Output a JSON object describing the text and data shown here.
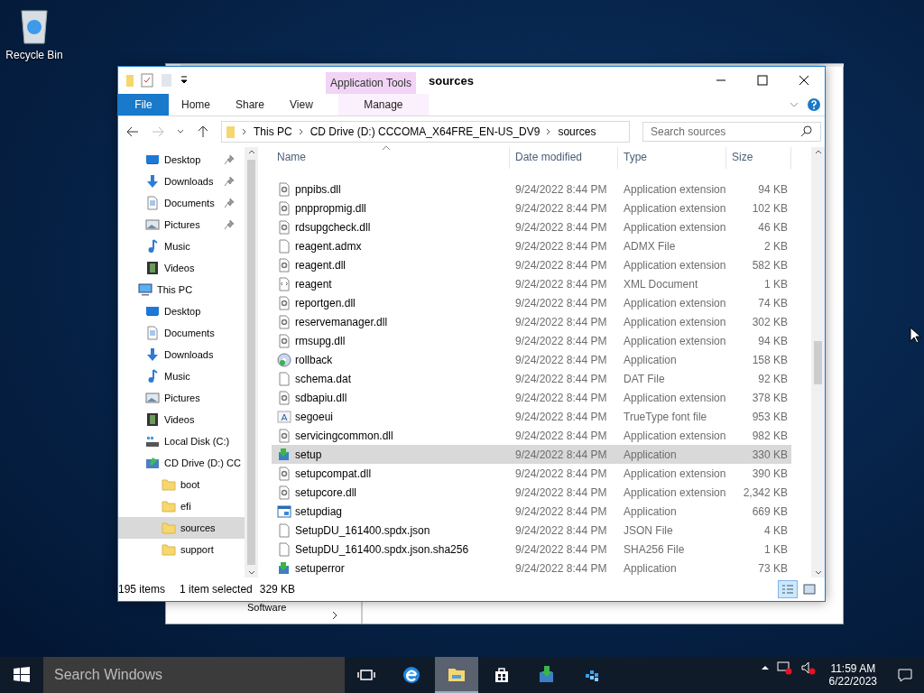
{
  "desktop_icons": [
    {
      "label": "Recycle Bin",
      "kind": "recycle"
    }
  ],
  "background_window": {
    "nav_item": "Software"
  },
  "window": {
    "title": "sources",
    "context_tab_group": "Application Tools",
    "ribbon_tabs": [
      {
        "label": "File",
        "kind": "file",
        "selected": false
      },
      {
        "label": "Home",
        "kind": "tab",
        "selected": false
      },
      {
        "label": "Share",
        "kind": "tab",
        "selected": false
      },
      {
        "label": "View",
        "kind": "tab",
        "selected": false
      },
      {
        "label": "Manage",
        "kind": "context",
        "selected": false
      }
    ],
    "address": {
      "breadcrumbs": [
        "This PC",
        "CD Drive (D:) CCCOMA_X64FRE_EN-US_DV9",
        "sources"
      ]
    },
    "search": {
      "placeholder": "Search sources"
    },
    "nav": [
      {
        "label": "Desktop",
        "kind": "desktop",
        "pinned": true,
        "selected": false
      },
      {
        "label": "Downloads",
        "kind": "downloads",
        "pinned": true,
        "selected": false
      },
      {
        "label": "Documents",
        "kind": "documents",
        "pinned": true,
        "selected": false
      },
      {
        "label": "Pictures",
        "kind": "pictures",
        "pinned": true,
        "selected": false
      },
      {
        "label": "Music",
        "kind": "music",
        "pinned": false,
        "selected": false
      },
      {
        "label": "Videos",
        "kind": "videos",
        "pinned": false,
        "selected": false
      },
      {
        "label": "This PC",
        "kind": "pc",
        "pinned": false,
        "selected": false,
        "children": [
          {
            "label": "Desktop",
            "kind": "desktop",
            "pinned": false,
            "selected": false
          },
          {
            "label": "Documents",
            "kind": "documents",
            "pinned": false,
            "selected": false
          },
          {
            "label": "Downloads",
            "kind": "downloads",
            "pinned": false,
            "selected": false
          },
          {
            "label": "Music",
            "kind": "music",
            "pinned": false,
            "selected": false
          },
          {
            "label": "Pictures",
            "kind": "pictures",
            "pinned": false,
            "selected": false
          },
          {
            "label": "Videos",
            "kind": "videos",
            "pinned": false,
            "selected": false
          },
          {
            "label": "Local Disk (C:)",
            "kind": "disk",
            "pinned": false,
            "selected": false
          },
          {
            "label": "CD Drive (D:) CC",
            "kind": "cd",
            "pinned": false,
            "selected": false,
            "children": [
              {
                "label": "boot",
                "kind": "folder",
                "pinned": false,
                "selected": false
              },
              {
                "label": "efi",
                "kind": "folder",
                "pinned": false,
                "selected": false
              },
              {
                "label": "sources",
                "kind": "folder",
                "pinned": false,
                "selected": true
              },
              {
                "label": "support",
                "kind": "folder",
                "pinned": false,
                "selected": false
              }
            ]
          }
        ]
      }
    ],
    "table": {
      "columns": [
        "Name",
        "Date modified",
        "Type",
        "Size"
      ],
      "rows": [
        {
          "name": "pnpibs.dll",
          "kind": "dll",
          "date": "9/24/2022 8:44 PM",
          "type": "Application extension",
          "size": "94 KB",
          "selected": false
        },
        {
          "name": "pnppropmig.dll",
          "kind": "dll",
          "date": "9/24/2022 8:44 PM",
          "type": "Application extension",
          "size": "102 KB",
          "selected": false
        },
        {
          "name": "rdsupgcheck.dll",
          "kind": "dll",
          "date": "9/24/2022 8:44 PM",
          "type": "Application extension",
          "size": "46 KB",
          "selected": false
        },
        {
          "name": "reagent.admx",
          "kind": "file",
          "date": "9/24/2022 8:44 PM",
          "type": "ADMX File",
          "size": "2 KB",
          "selected": false
        },
        {
          "name": "reagent.dll",
          "kind": "dll",
          "date": "9/24/2022 8:44 PM",
          "type": "Application extension",
          "size": "582 KB",
          "selected": false
        },
        {
          "name": "reagent",
          "kind": "xml",
          "date": "9/24/2022 8:44 PM",
          "type": "XML Document",
          "size": "1 KB",
          "selected": false
        },
        {
          "name": "reportgen.dll",
          "kind": "dll",
          "date": "9/24/2022 8:44 PM",
          "type": "Application extension",
          "size": "74 KB",
          "selected": false
        },
        {
          "name": "reservemanager.dll",
          "kind": "dll",
          "date": "9/24/2022 8:44 PM",
          "type": "Application extension",
          "size": "302 KB",
          "selected": false
        },
        {
          "name": "rmsupg.dll",
          "kind": "dll",
          "date": "9/24/2022 8:44 PM",
          "type": "Application extension",
          "size": "94 KB",
          "selected": false
        },
        {
          "name": "rollback",
          "kind": "disc",
          "date": "9/24/2022 8:44 PM",
          "type": "Application",
          "size": "158 KB",
          "selected": false
        },
        {
          "name": "schema.dat",
          "kind": "file",
          "date": "9/24/2022 8:44 PM",
          "type": "DAT File",
          "size": "92 KB",
          "selected": false
        },
        {
          "name": "sdbapiu.dll",
          "kind": "dll",
          "date": "9/24/2022 8:44 PM",
          "type": "Application extension",
          "size": "378 KB",
          "selected": false
        },
        {
          "name": "segoeui",
          "kind": "font",
          "date": "9/24/2022 8:44 PM",
          "type": "TrueType font file",
          "size": "953 KB",
          "selected": false
        },
        {
          "name": "servicingcommon.dll",
          "kind": "dll",
          "date": "9/24/2022 8:44 PM",
          "type": "Application extension",
          "size": "982 KB",
          "selected": false
        },
        {
          "name": "setup",
          "kind": "setup",
          "date": "9/24/2022 8:44 PM",
          "type": "Application",
          "size": "330 KB",
          "selected": true
        },
        {
          "name": "setupcompat.dll",
          "kind": "dll",
          "date": "9/24/2022 8:44 PM",
          "type": "Application extension",
          "size": "390 KB",
          "selected": false
        },
        {
          "name": "setupcore.dll",
          "kind": "dll",
          "date": "9/24/2022 8:44 PM",
          "type": "Application extension",
          "size": "2,342 KB",
          "selected": false
        },
        {
          "name": "setupdiag",
          "kind": "app",
          "date": "9/24/2022 8:44 PM",
          "type": "Application",
          "size": "669 KB",
          "selected": false
        },
        {
          "name": "SetupDU_161400.spdx.json",
          "kind": "file",
          "date": "9/24/2022 8:44 PM",
          "type": "JSON File",
          "size": "4 KB",
          "selected": false
        },
        {
          "name": "SetupDU_161400.spdx.json.sha256",
          "kind": "file",
          "date": "9/24/2022 8:44 PM",
          "type": "SHA256 File",
          "size": "1 KB",
          "selected": false
        },
        {
          "name": "setuperror",
          "kind": "setup",
          "date": "9/24/2022 8:44 PM",
          "type": "Application",
          "size": "73 KB",
          "selected": false
        }
      ]
    },
    "status_bar": {
      "item_count": "195 items",
      "selection": "1 item selected",
      "selection_size": "329 KB"
    },
    "views": [
      {
        "kind": "details",
        "selected": true
      },
      {
        "kind": "tiles",
        "selected": false
      }
    ]
  },
  "taskbar": {
    "search_placeholder": "Search Windows",
    "apps": [
      {
        "kind": "taskview",
        "selected": false
      },
      {
        "kind": "edge",
        "selected": false
      },
      {
        "kind": "explorer",
        "selected": true
      },
      {
        "kind": "store",
        "selected": false
      },
      {
        "kind": "setup",
        "selected": false
      },
      {
        "kind": "blocks",
        "selected": false
      }
    ],
    "time": "11:59 AM",
    "date": "6/22/2023"
  }
}
